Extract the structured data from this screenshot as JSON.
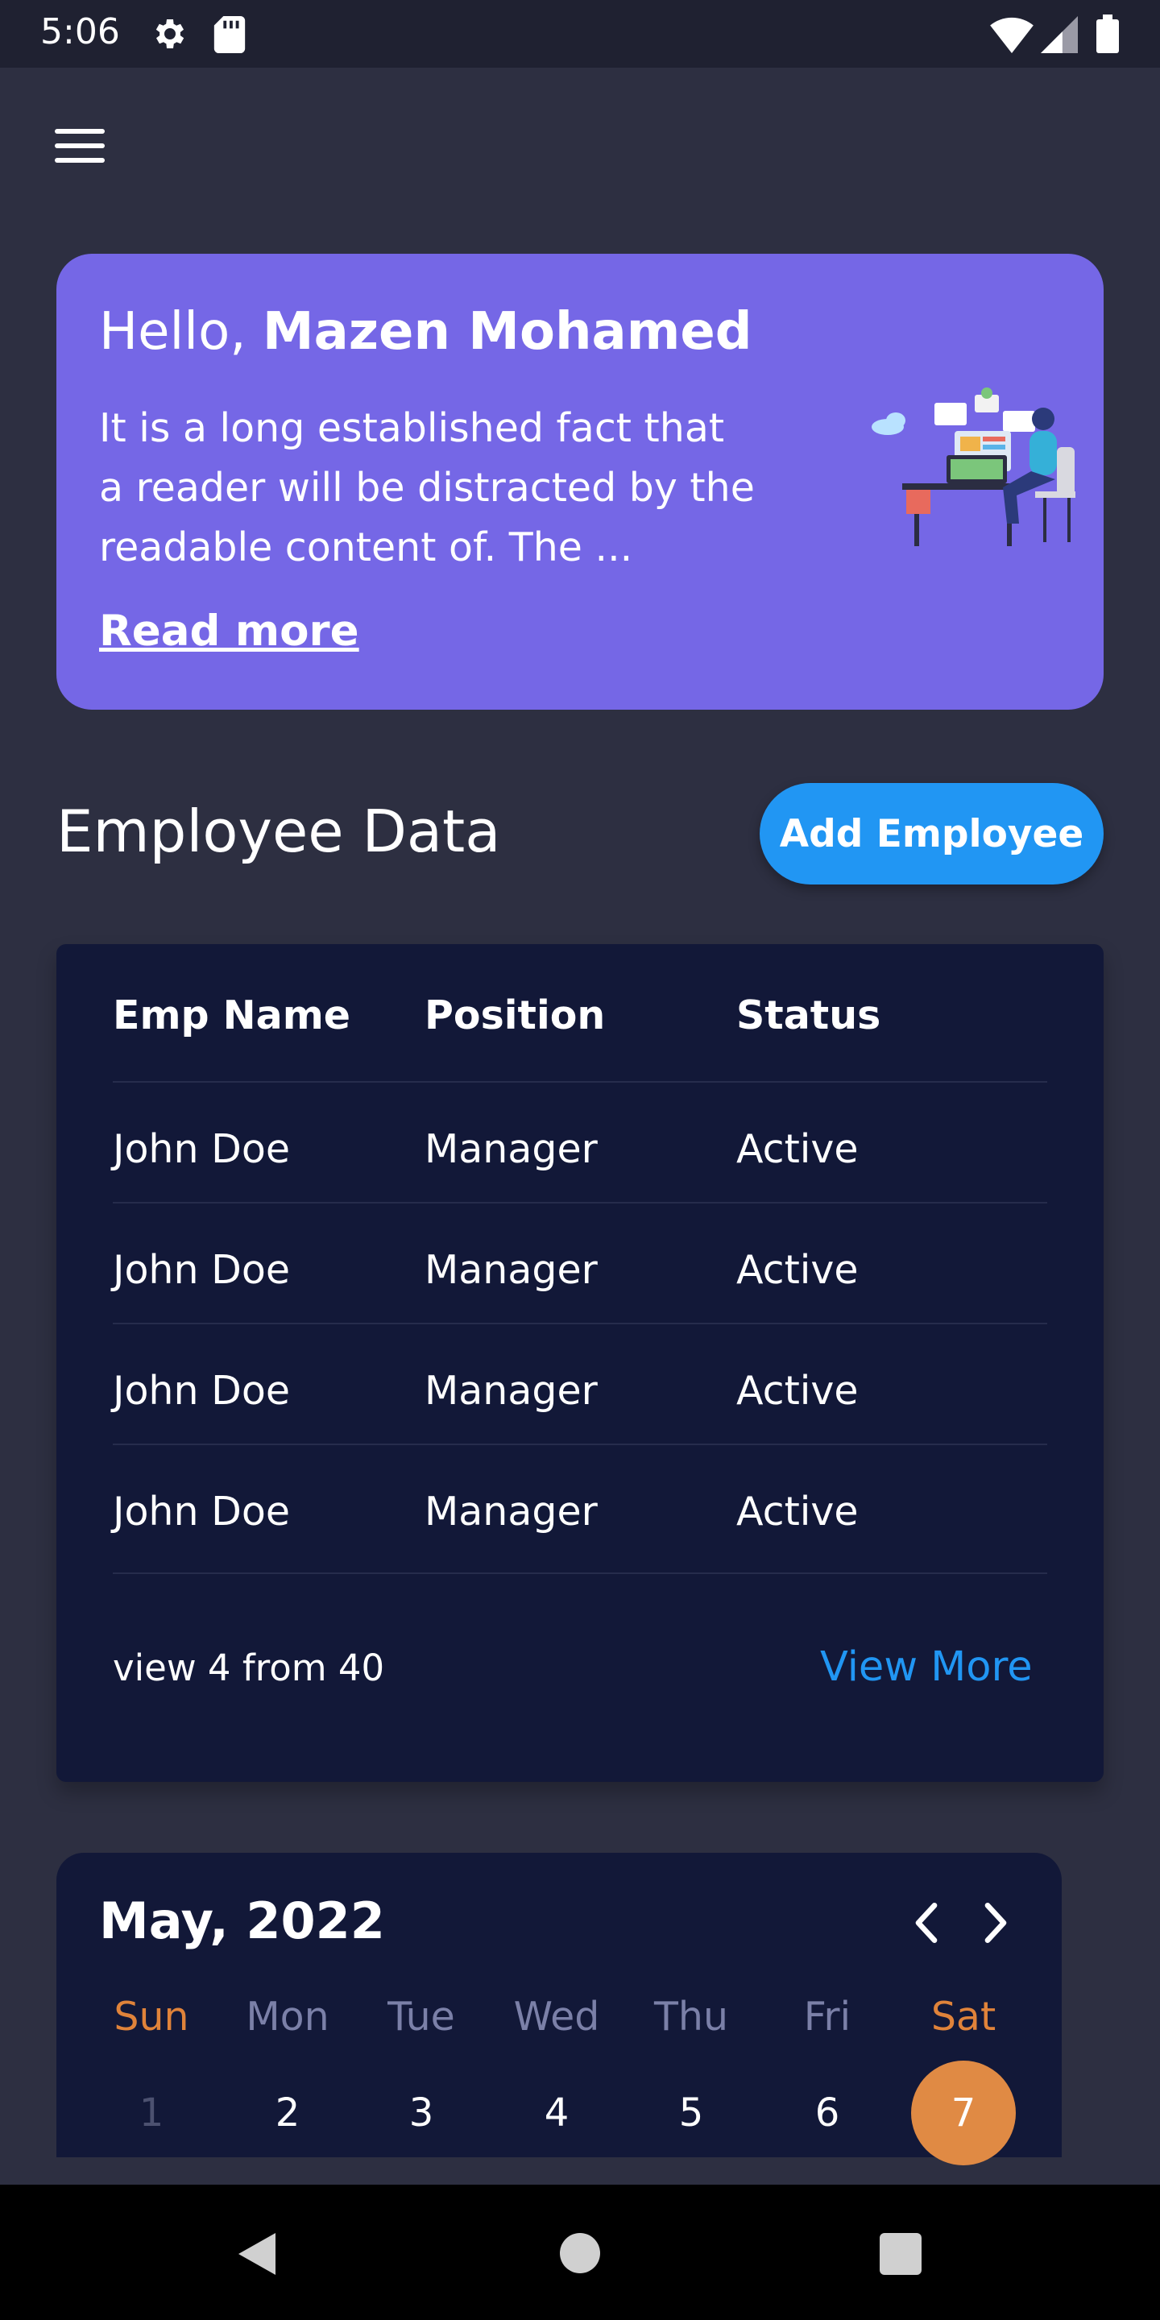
{
  "status_bar": {
    "time": "5:06"
  },
  "hero": {
    "greeting_prefix": "Hello,",
    "user_name": "Mazen Mohamed",
    "text": "It is a long established fact that a reader will be distracted by the readable content of. The ...",
    "read_more": "Read more"
  },
  "employees": {
    "title": "Employee Data",
    "add_button": "Add Employee",
    "columns": [
      "Emp Name",
      "Position",
      "Status"
    ],
    "rows": [
      [
        "John Doe",
        "Manager",
        "Active"
      ],
      [
        "John Doe",
        "Manager",
        "Active"
      ],
      [
        "John Doe",
        "Manager",
        "Active"
      ],
      [
        "John Doe",
        "Manager",
        "Active"
      ]
    ],
    "count_text": "view 4 from 40",
    "view_more": "View More"
  },
  "calendar": {
    "month": "May, 2022",
    "weekdays": [
      "Sun",
      "Mon",
      "Tue",
      "Wed",
      "Thu",
      "Fri",
      "Sat"
    ],
    "days": [
      "1",
      "2",
      "3",
      "4",
      "5",
      "6",
      "7"
    ],
    "selected_day": "7"
  },
  "colors": {
    "background": "#2d2f41",
    "hero_card": "#7567e6",
    "accent_blue": "#2196f3",
    "table_card": "#121838",
    "weekend": "#e0833a",
    "today": "#e08a44"
  }
}
